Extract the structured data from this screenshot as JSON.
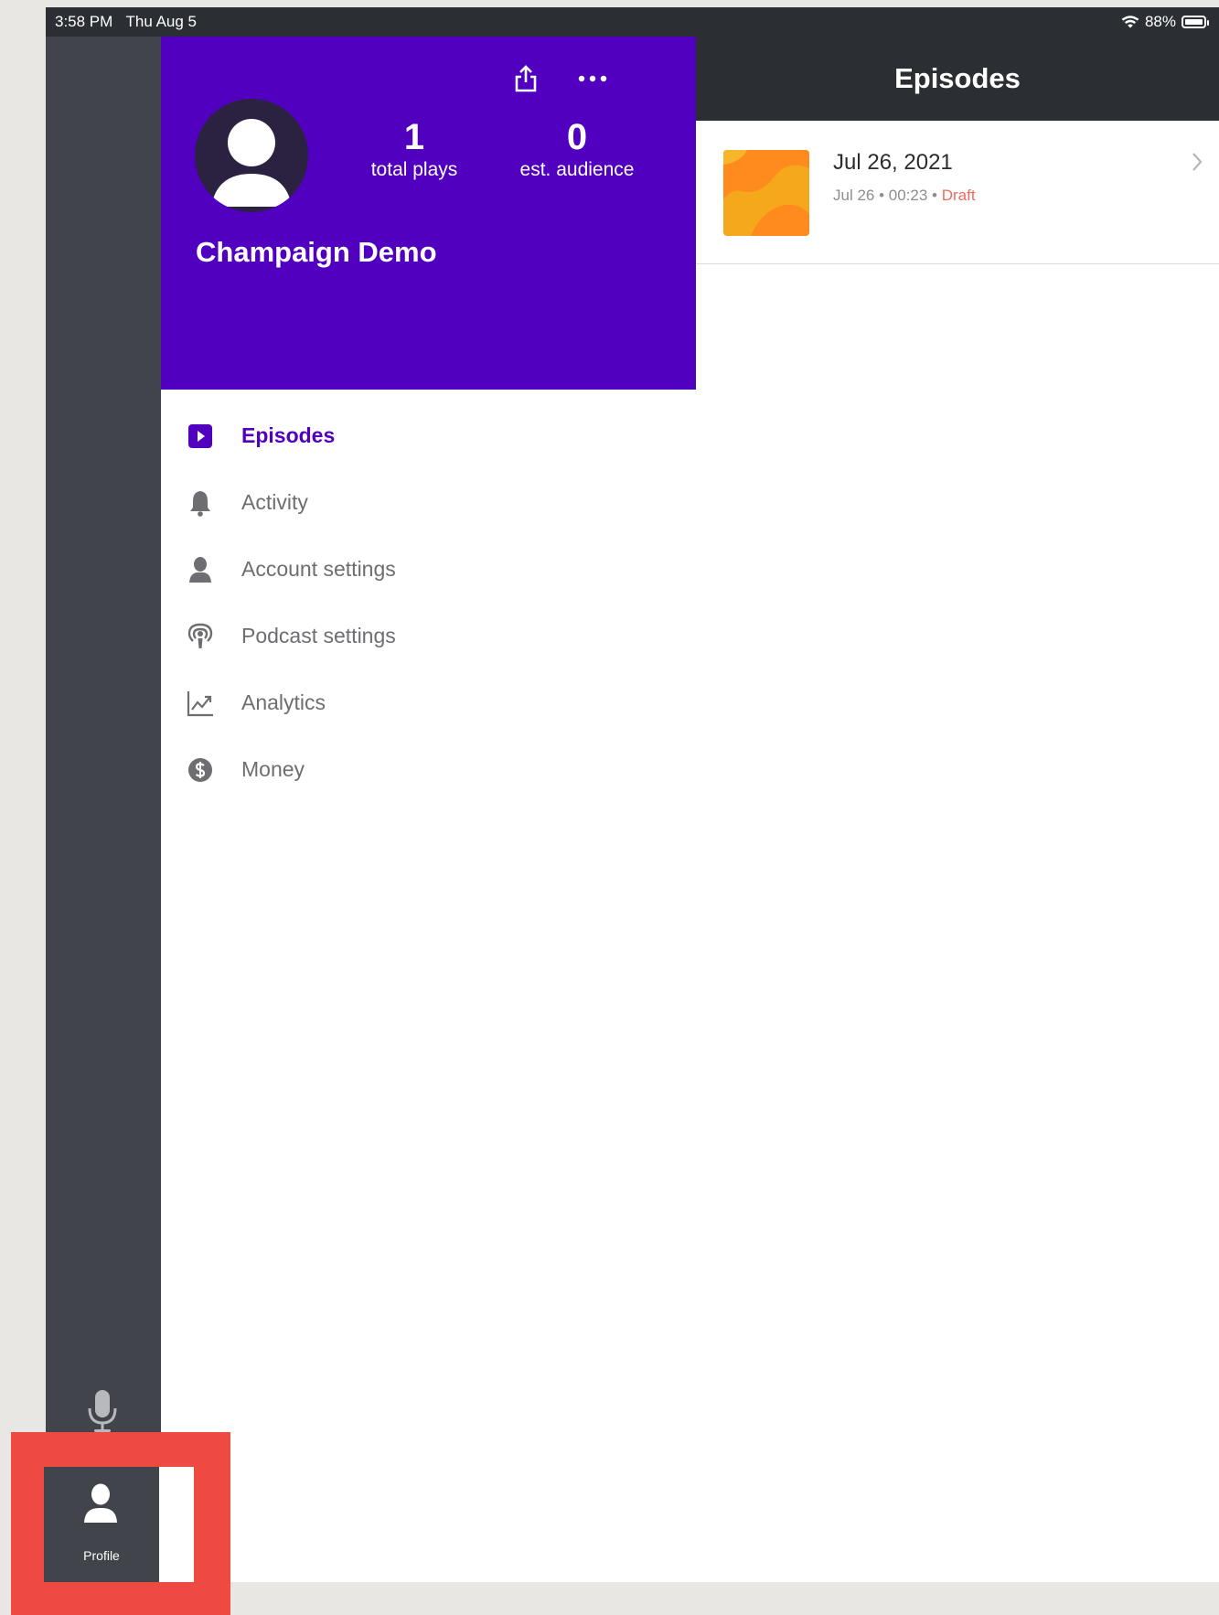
{
  "status_bar": {
    "time": "3:58 PM",
    "date": "Thu Aug 5",
    "battery": "88%",
    "wifi_icon": "wifi-icon"
  },
  "rail": {
    "mic_icon": "microphone-icon",
    "profile_label": "Profile",
    "profile_icon": "person-icon"
  },
  "profile": {
    "stats": [
      {
        "value": "1",
        "label": "total plays"
      },
      {
        "value": "0",
        "label": "est. audience"
      }
    ],
    "podcast_name": "Champaign Demo",
    "header_color": "#5200bf"
  },
  "menu": [
    {
      "label": "Episodes",
      "icon": "play-square-icon",
      "active": true
    },
    {
      "label": "Activity",
      "icon": "bell-icon"
    },
    {
      "label": "Account settings",
      "icon": "person-icon"
    },
    {
      "label": "Podcast settings",
      "icon": "podcast-icon"
    },
    {
      "label": "Analytics",
      "icon": "chart-icon"
    },
    {
      "label": "Money",
      "icon": "dollar-icon"
    }
  ],
  "content": {
    "title": "Episodes",
    "episodes": [
      {
        "title": "Jul 26, 2021",
        "date": "Jul 26",
        "duration": "00:23",
        "status": "Draft"
      }
    ]
  },
  "colors": {
    "accent": "#5200bf",
    "draft": "#f06a5d",
    "highlight": "#ee4a41",
    "dark": "#2b2e33"
  }
}
